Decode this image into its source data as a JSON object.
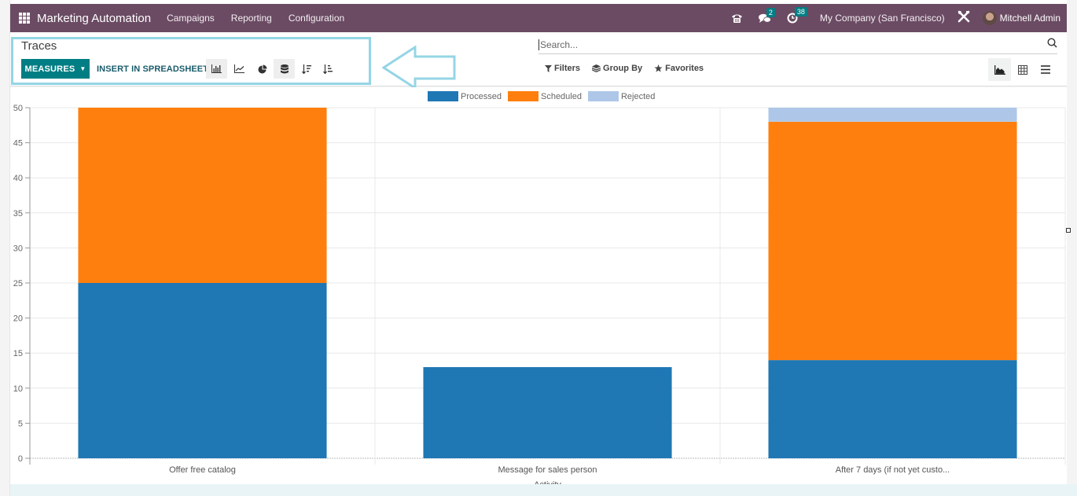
{
  "navbar": {
    "brand": "Marketing Automation",
    "menu": [
      "Campaigns",
      "Reporting",
      "Configuration"
    ],
    "messages_badge": "2",
    "activities_badge": "38",
    "company": "My Company (San Francisco)",
    "user": "Mitchell Admin",
    "icons": [
      "apps-grid-icon",
      "phone-icon",
      "chat-icon",
      "clock-icon",
      "tools-icon",
      "avatar"
    ]
  },
  "control_panel": {
    "breadcrumb": "Traces",
    "measures_label": "MEASURES",
    "insert_label": "INSERT IN SPREADSHEET",
    "chart_buttons": [
      "bar-chart",
      "line-chart",
      "pie-chart",
      "stacked",
      "sort-descending",
      "sort-ascending"
    ],
    "active_chart_buttons": [
      "bar-chart",
      "stacked"
    ],
    "search_placeholder": "Search...",
    "filters_label": "Filters",
    "groupby_label": "Group By",
    "favorites_label": "Favorites",
    "views": [
      "graph",
      "pivot",
      "list"
    ],
    "active_view": "graph"
  },
  "colors": {
    "navbar": "#6b4b63",
    "primary": "#017e84",
    "processed": "#1f77b4",
    "scheduled": "#ff7f0e",
    "rejected": "#aec7e8",
    "highlight": "#94d5e6"
  },
  "chart_data": {
    "type": "bar",
    "stacked": true,
    "categories": [
      "Offer free catalog",
      "Message for sales person",
      "After 7 days (if not yet custo..."
    ],
    "series": [
      {
        "name": "Processed",
        "color": "#1f77b4",
        "values": [
          25,
          13,
          14
        ]
      },
      {
        "name": "Scheduled",
        "color": "#ff7f0e",
        "values": [
          25,
          0,
          34
        ]
      },
      {
        "name": "Rejected",
        "color": "#aec7e8",
        "values": [
          0,
          0,
          2
        ]
      }
    ],
    "xlabel": "Activity",
    "ylabel": "",
    "ylim": [
      0,
      50
    ],
    "yticks": [
      0,
      5,
      10,
      15,
      20,
      25,
      30,
      35,
      40,
      45,
      50
    ],
    "grid": true,
    "legend": "top-center"
  }
}
